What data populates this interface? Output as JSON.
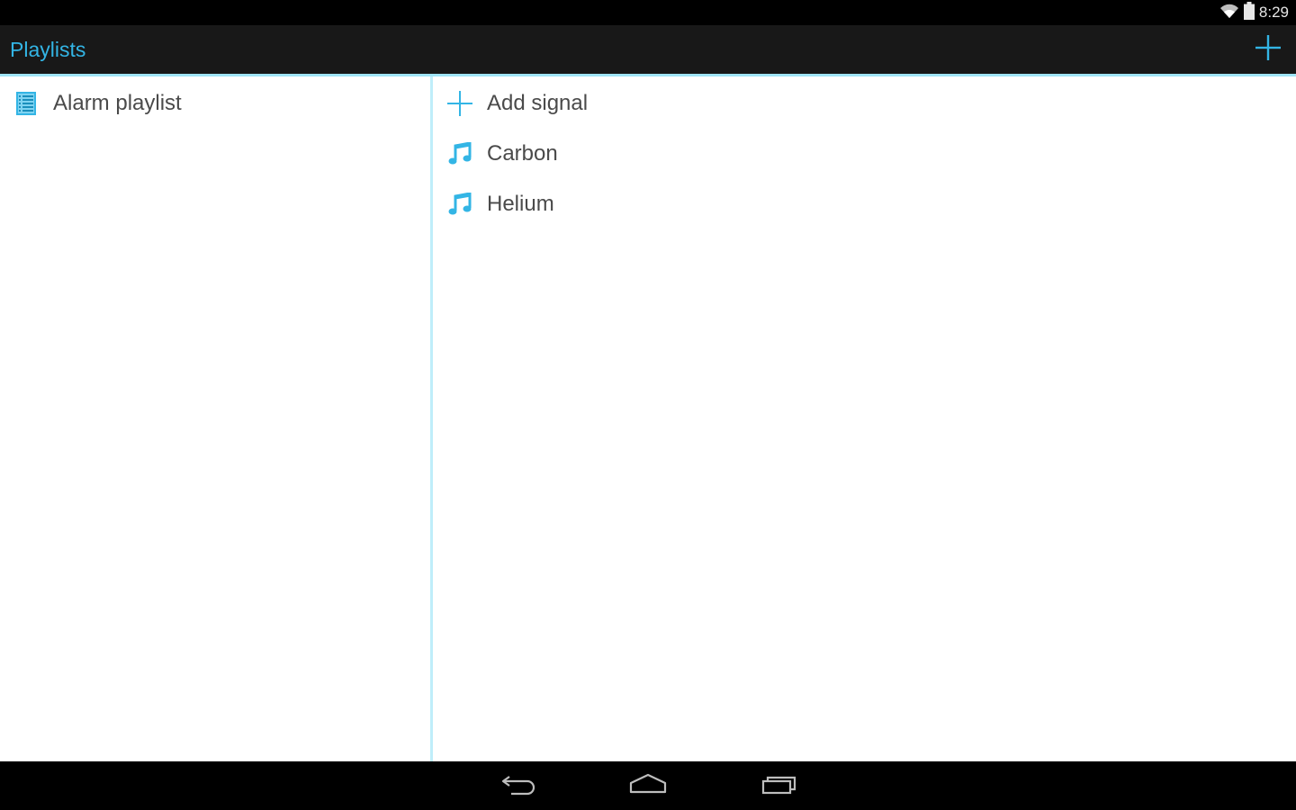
{
  "status_bar": {
    "time": "8:29",
    "icons": [
      "wifi-icon",
      "battery-icon"
    ]
  },
  "action_bar": {
    "title": "Playlists",
    "add_icon": "plus-icon",
    "accent_color": "#33b5e5"
  },
  "playlists": [
    {
      "label": "Alarm playlist",
      "icon": "playlist-icon"
    }
  ],
  "signals": {
    "add_label": "Add signal",
    "add_icon": "plus-icon",
    "items": [
      {
        "label": "Carbon",
        "icon": "music-note-icon"
      },
      {
        "label": "Helium",
        "icon": "music-note-icon"
      }
    ]
  },
  "nav_bar": {
    "icons": [
      "back-icon",
      "home-icon",
      "recent-apps-icon"
    ]
  }
}
